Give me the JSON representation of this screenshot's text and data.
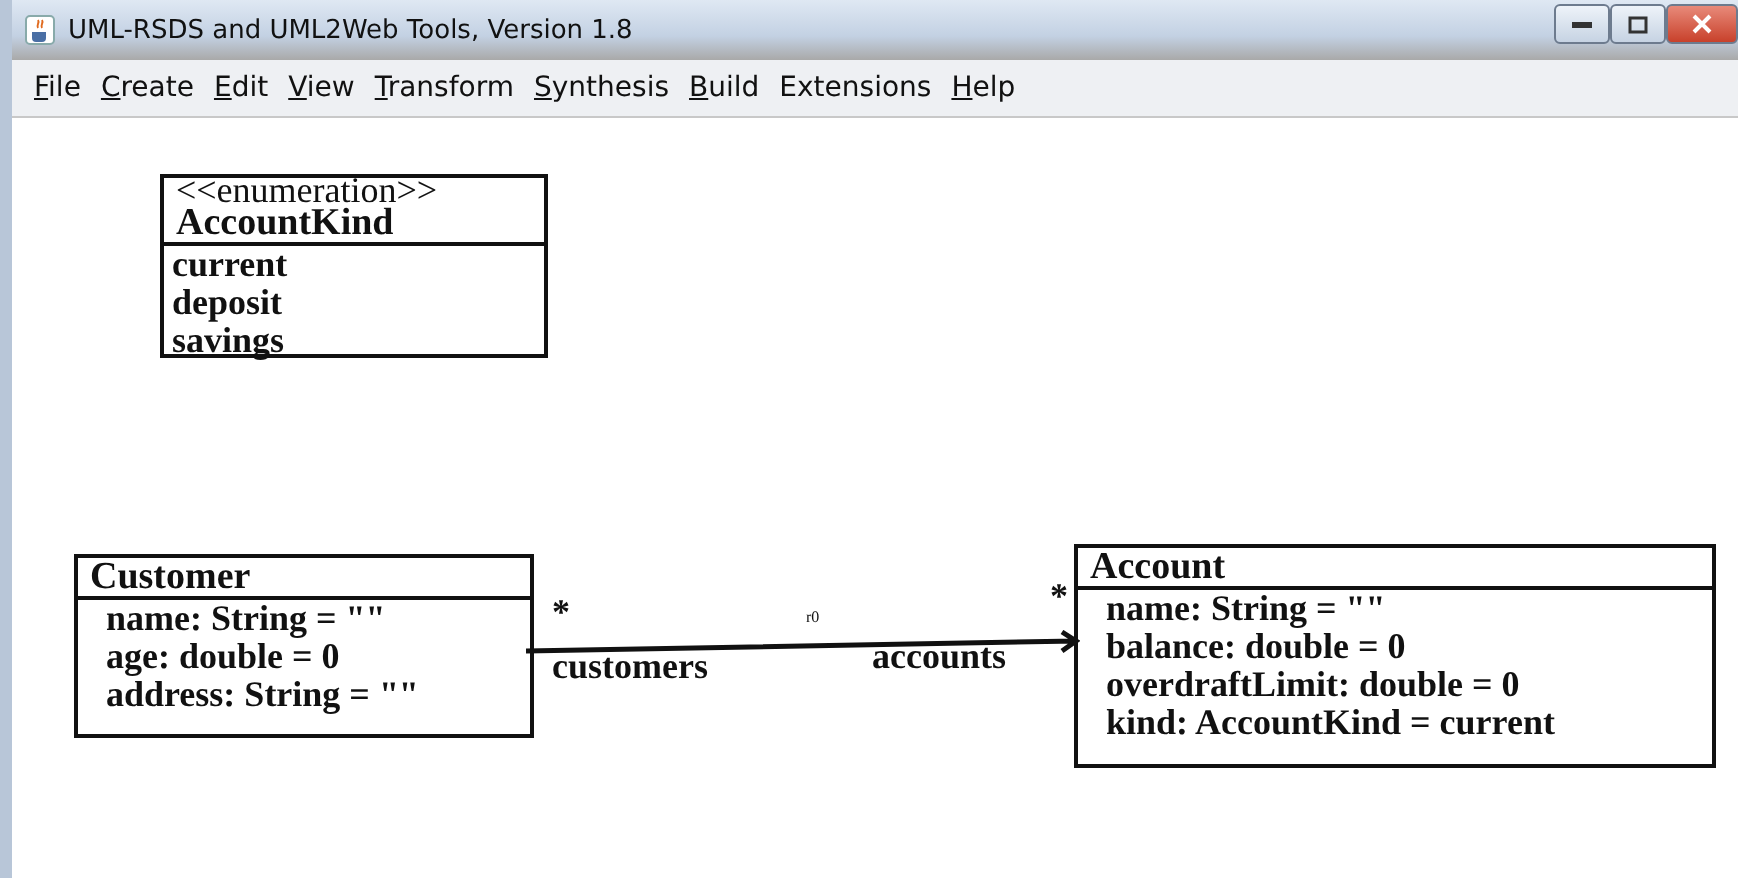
{
  "window": {
    "title": "UML-RSDS and UML2Web Tools, Version 1.8"
  },
  "menu": [
    {
      "label": "File",
      "mnemonic": true
    },
    {
      "label": "Create",
      "mnemonic": true
    },
    {
      "label": "Edit",
      "mnemonic": true
    },
    {
      "label": "View",
      "mnemonic": true
    },
    {
      "label": "Transform",
      "mnemonic": true
    },
    {
      "label": "Synthesis",
      "mnemonic": true
    },
    {
      "label": "Build",
      "mnemonic": true
    },
    {
      "label": "Extensions",
      "mnemonic": false
    },
    {
      "label": "Help",
      "mnemonic": true
    }
  ],
  "diagram": {
    "classes": [
      {
        "stereotype": "<<enumeration>>",
        "name": "AccountKind",
        "members": [
          "current",
          "deposit",
          "savings"
        ]
      },
      {
        "name": "Customer",
        "members": [
          "name: String = \"\"",
          "age: double = 0",
          "address: String = \"\""
        ]
      },
      {
        "name": "Account",
        "members": [
          "name: String = \"\"",
          "balance: double = 0",
          "overdraftLimit: double = 0",
          "kind: AccountKind = current"
        ]
      }
    ],
    "association": {
      "source_multiplicity": "*",
      "source_role": "customers",
      "name": "r0",
      "target_role": "accounts",
      "target_multiplicity": "*"
    }
  }
}
